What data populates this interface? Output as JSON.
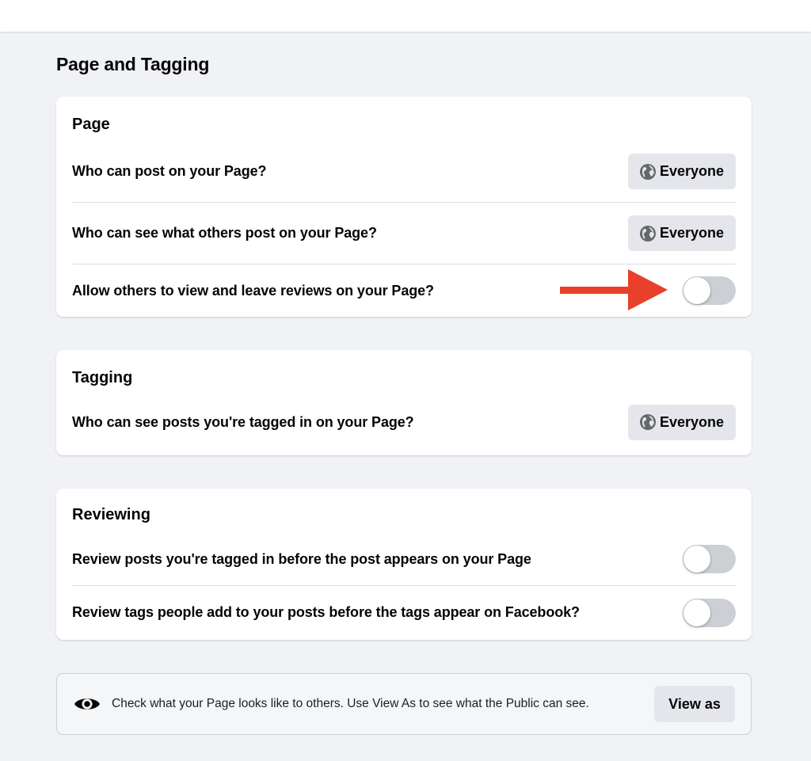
{
  "page_title": "Page and Tagging",
  "sections": [
    {
      "title": "Page",
      "rows": [
        {
          "label": "Who can post on your Page?",
          "control": "button",
          "value": "Everyone",
          "icon": "globe-icon"
        },
        {
          "label": "Who can see what others post on your Page?",
          "control": "button",
          "value": "Everyone",
          "icon": "globe-icon"
        },
        {
          "label": "Allow others to view and leave reviews on your Page?",
          "control": "toggle",
          "checked": false
        }
      ]
    },
    {
      "title": "Tagging",
      "rows": [
        {
          "label": "Who can see posts you're tagged in on your Page?",
          "control": "button",
          "value": "Everyone",
          "icon": "globe-icon"
        }
      ]
    },
    {
      "title": "Reviewing",
      "rows": [
        {
          "label": "Review posts you're tagged in before the post appears on your Page",
          "control": "toggle",
          "checked": false
        },
        {
          "label": "Review tags people add to your posts before the tags appear on Facebook?",
          "control": "toggle",
          "checked": false
        }
      ]
    }
  ],
  "view_as": {
    "icon": "eye-icon",
    "text": "Check what your Page looks like to others. Use View As to see what the Public can see.",
    "button_label": "View as"
  },
  "annotation": {
    "icon": "arrow-right-icon",
    "color": "#e8402a"
  },
  "colors": {
    "background": "#f0f2f5",
    "card": "#ffffff",
    "button": "#e4e6eb",
    "toggle_off": "#ccd0d5"
  }
}
